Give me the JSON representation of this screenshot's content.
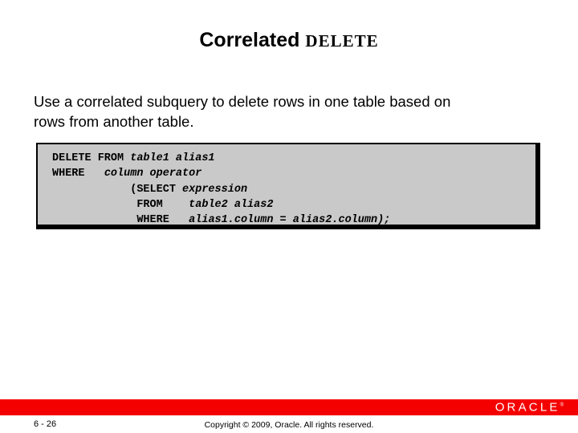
{
  "slide": {
    "title": {
      "main": "Correlated",
      "code": "DELETE"
    },
    "body": {
      "line1": "Use a correlated subquery to delete rows in one table based on",
      "line2": "rows from another table."
    },
    "code_block": {
      "lines": [
        {
          "keyword": "DELETE FROM ",
          "placeholder": "table1 alias1"
        },
        {
          "keyword": "WHERE   ",
          "placeholder": "column operator"
        },
        {
          "keyword": "            (SELECT ",
          "placeholder": "expression"
        },
        {
          "keyword": "             FROM    ",
          "placeholder": "table2 alias2"
        },
        {
          "keyword": "             WHERE   ",
          "placeholder": "alias1.column = alias2.column);"
        }
      ]
    },
    "footer": {
      "logo": "ORACLE",
      "logo_trademark": "®",
      "slide_number": "6 - 26",
      "copyright": "Copyright © 2009, Oracle. All rights reserved."
    },
    "colors": {
      "footer_bar": "#f50000",
      "code_background": "#c9c9c9",
      "text": "#000000",
      "page_background": "#ffffff"
    }
  }
}
